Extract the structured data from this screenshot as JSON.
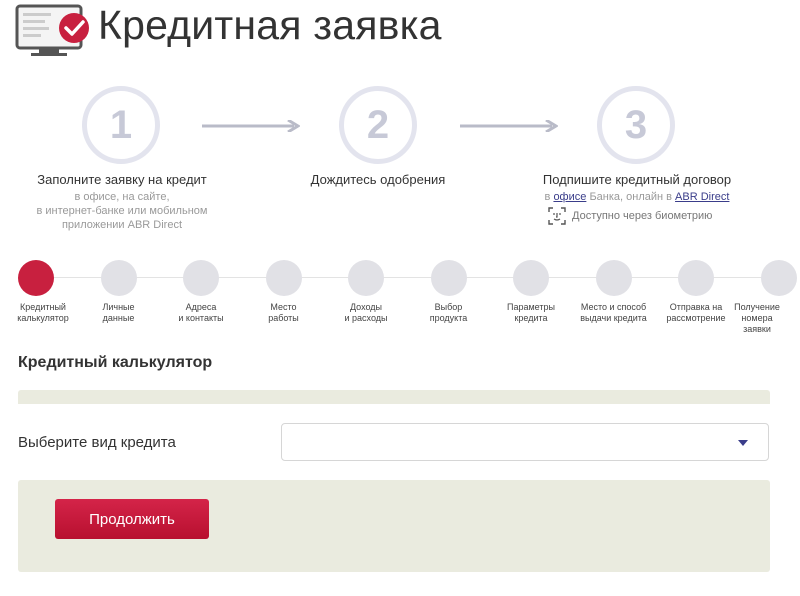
{
  "header": {
    "title": "Кредитная заявка",
    "icon": "monitor-approved-icon"
  },
  "steps": [
    {
      "number": "1",
      "title": "Заполните заявку на кредит",
      "desc_lines": [
        "в офисе, на сайте,",
        "в интернет-банке или мобильном",
        "приложении ABR Direct"
      ]
    },
    {
      "number": "2",
      "title": "Дождитесь одобрения"
    },
    {
      "number": "3",
      "title": "Подпишите кредитный договор",
      "desc_prefix": "в",
      "desc_link_office": "офисе",
      "desc_middle": "Банка, онлайн в",
      "desc_link_app": "ABR Direct",
      "biometry": "Доступно через биометрию"
    }
  ],
  "progress": {
    "active_index": 0,
    "items": [
      [
        "Кредитный",
        "калькулятор"
      ],
      [
        "Личные",
        "данные"
      ],
      [
        "Адреса",
        "и контакты"
      ],
      [
        "Место",
        "работы"
      ],
      [
        "Доходы",
        "и расходы"
      ],
      [
        "Выбор",
        "продукта"
      ],
      [
        "Параметры",
        "кредита"
      ],
      [
        "Место и способ",
        "выдачи кредита"
      ],
      [
        "Отправка на",
        "рассмотрение"
      ],
      [
        "Получение",
        "номера",
        "заявки"
      ]
    ]
  },
  "calculator": {
    "title": "Кредитный калькулятор",
    "select_label": "Выберите вид кредита",
    "select_value": "",
    "continue_label": "Продолжить"
  },
  "colors": {
    "accent": "#c8203f",
    "link": "#3a3d8a",
    "panel": "#eaebdf",
    "step_circle": "#e3e4ee"
  }
}
